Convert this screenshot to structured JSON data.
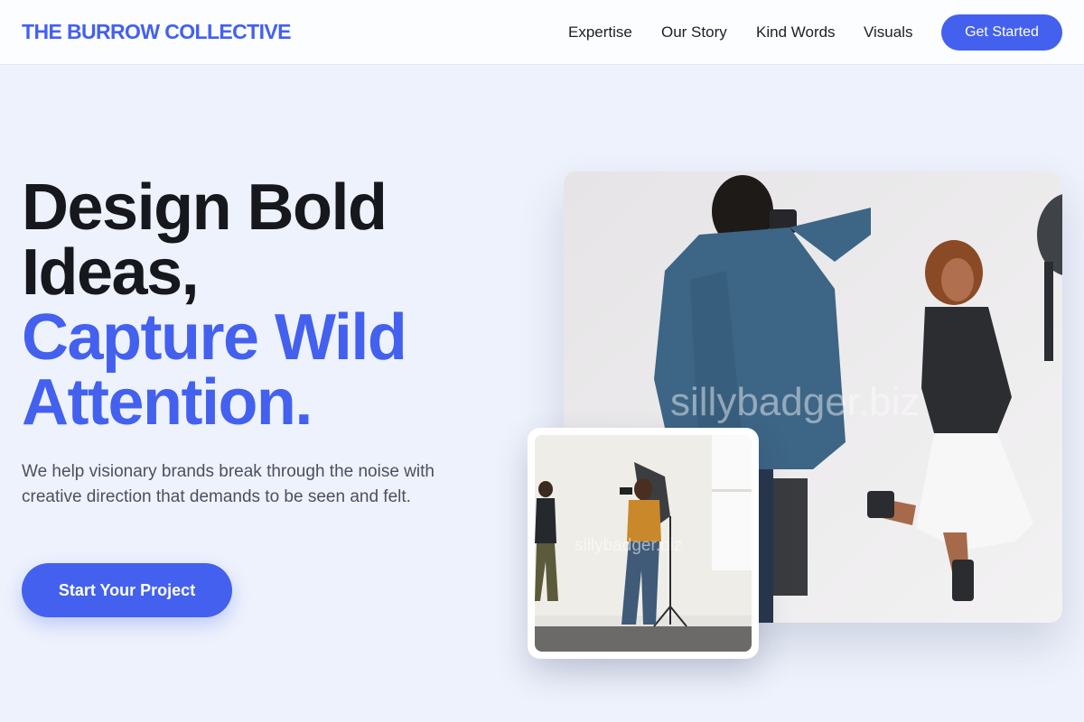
{
  "header": {
    "brand": "THE BURROW COLLECTIVE",
    "nav": [
      "Expertise",
      "Our Story",
      "Kind Words",
      "Visuals"
    ],
    "cta_label": "Get Started"
  },
  "hero": {
    "title_line1": "Design Bold",
    "title_line2": "Ideas,",
    "title_line3": "Capture Wild",
    "title_line4": "Attention.",
    "description": "We help visionary brands break through the noise with creative direction that demands to be seen and felt.",
    "cta_label": "Start Your Project"
  },
  "images": {
    "main_watermark": "sillybadger.biz",
    "small_watermark": "sillybadger.biz"
  },
  "colors": {
    "accent": "#4361ee",
    "heading": "#16181d",
    "body_text": "#4b5060",
    "page_background": "#eef2fc"
  }
}
